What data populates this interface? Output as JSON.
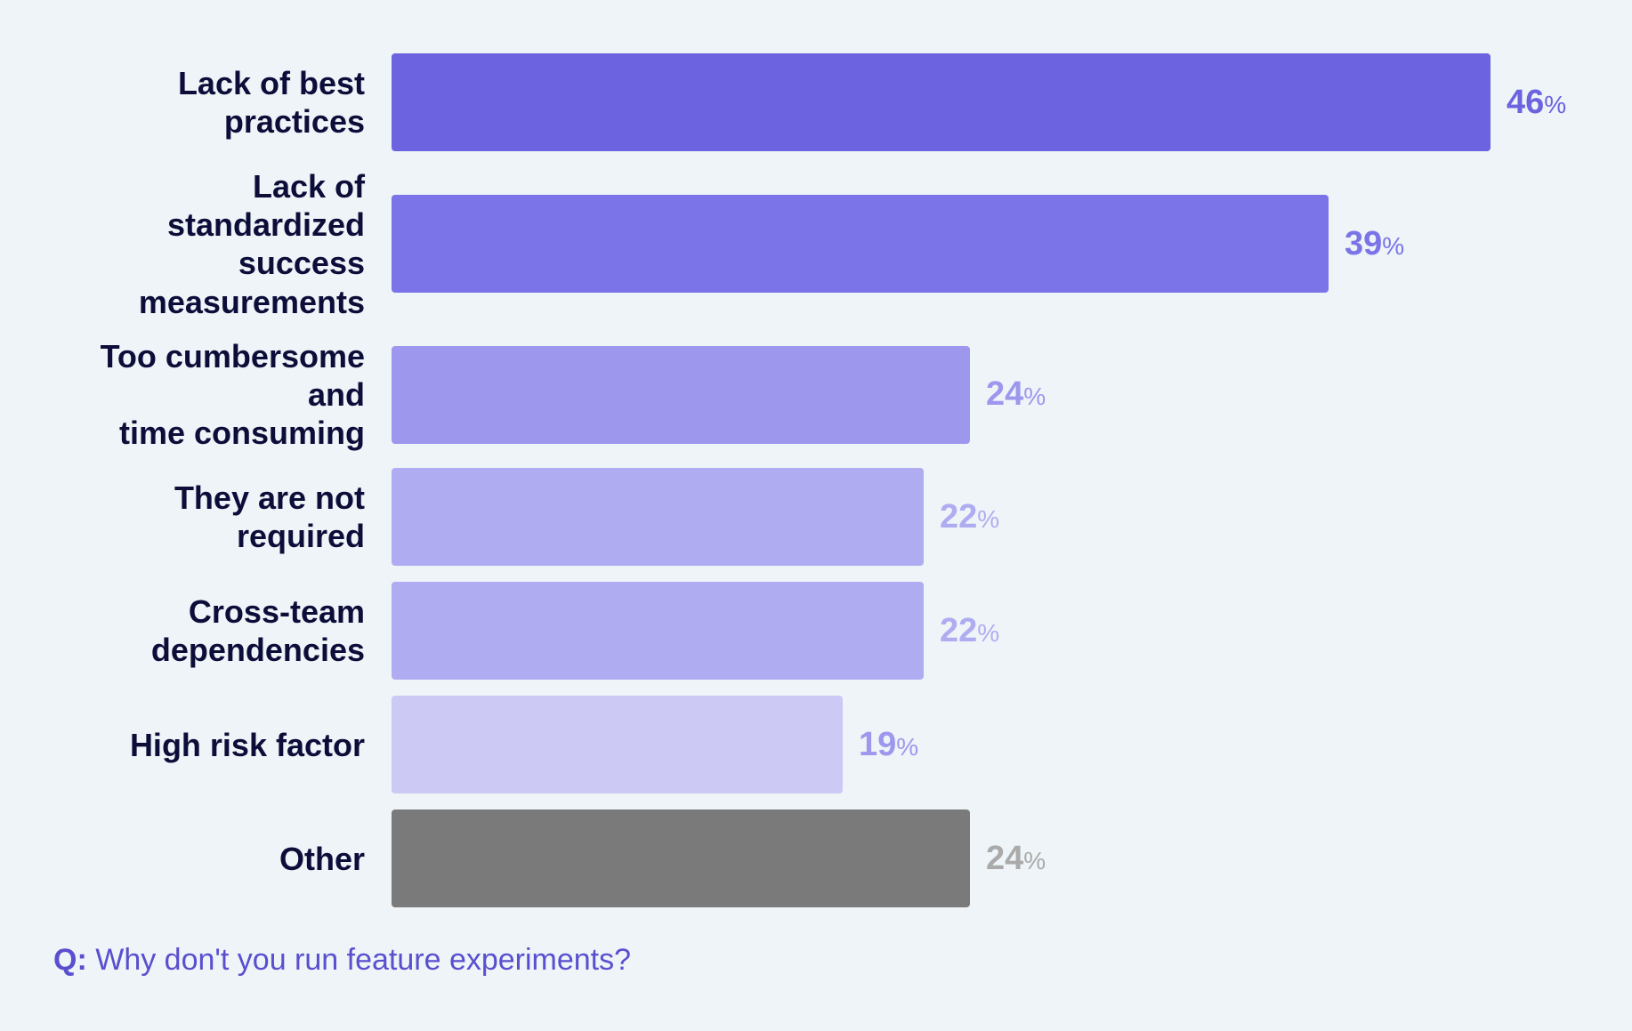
{
  "chart": {
    "bars": [
      {
        "label": "Lack of best practices",
        "value": 46,
        "barColor": "#6b63e0",
        "pctColor": "#6b63e0",
        "widthPct": 95
      },
      {
        "label": "Lack of standardized\nsuccess measurements",
        "value": 39,
        "barColor": "#7b74e8",
        "pctColor": "#7b74e8",
        "widthPct": 81
      },
      {
        "label": "Too cumbersome and\ntime consuming",
        "value": 24,
        "barColor": "#9d97ee",
        "pctColor": "#9d97ee",
        "widthPct": 50
      },
      {
        "label": "They are not required",
        "value": 22,
        "barColor": "#b0acf2",
        "pctColor": "#b0acf2",
        "widthPct": 46
      },
      {
        "label": "Cross-team\ndependencies",
        "value": 22,
        "barColor": "#b0acf2",
        "pctColor": "#b0acf2",
        "widthPct": 46
      },
      {
        "label": "High risk factor",
        "value": 19,
        "barColor": "#cdc9f5",
        "pctColor": "#9d97ee",
        "widthPct": 39
      },
      {
        "label": "Other",
        "value": 24,
        "barColor": "#7a7a7a",
        "pctColor": "#aaaaaa",
        "widthPct": 50
      }
    ],
    "question": {
      "prefix": "Q:",
      "text": " Why don't you run feature experiments?"
    }
  }
}
